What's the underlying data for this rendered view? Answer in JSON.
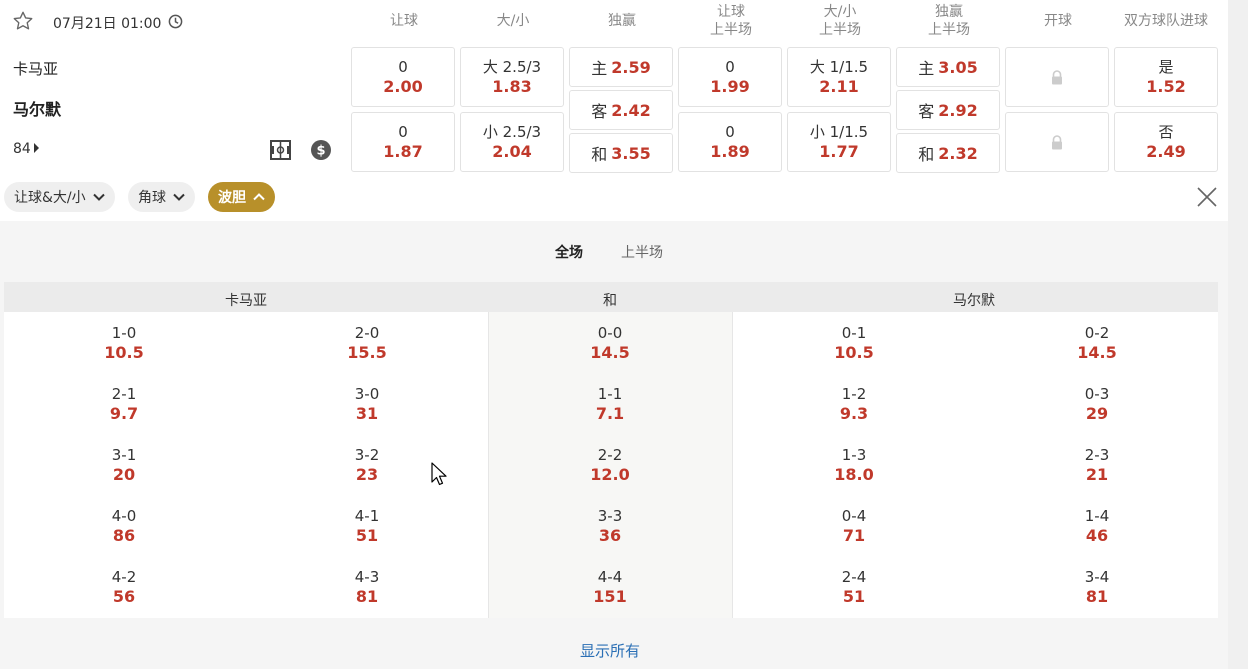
{
  "match": {
    "date": "07月21日 01:00",
    "home": "卡马亚",
    "away": "马尔默",
    "more_count": "84"
  },
  "columns": [
    "让球",
    "大/小",
    "独赢",
    "让球|上半场",
    "大/小|上半场",
    "独赢|上半场",
    "开球",
    "双方球队进球"
  ],
  "odds": {
    "handicap": [
      {
        "line": "0",
        "odd": "2.00"
      },
      {
        "line": "0",
        "odd": "1.87"
      }
    ],
    "total": [
      {
        "line": "大 2.5/3",
        "odd": "1.83"
      },
      {
        "line": "小 2.5/3",
        "odd": "2.04"
      }
    ],
    "moneyline": [
      {
        "label": "主",
        "odd": "2.59"
      },
      {
        "label": "客",
        "odd": "2.42"
      },
      {
        "label": "和",
        "odd": "3.55"
      }
    ],
    "handicap_1h": [
      {
        "line": "0",
        "odd": "1.99"
      },
      {
        "line": "0",
        "odd": "1.89"
      }
    ],
    "total_1h": [
      {
        "line": "大 1/1.5",
        "odd": "2.11"
      },
      {
        "line": "小 1/1.5",
        "odd": "1.77"
      }
    ],
    "moneyline_1h": [
      {
        "label": "主",
        "odd": "3.05"
      },
      {
        "label": "客",
        "odd": "2.92"
      },
      {
        "label": "和",
        "odd": "2.32"
      }
    ],
    "btts": [
      {
        "label": "是",
        "odd": "1.52"
      },
      {
        "label": "否",
        "odd": "2.49"
      }
    ]
  },
  "chips": [
    {
      "label": "让球&大/小",
      "active": false
    },
    {
      "label": "角球",
      "active": false
    },
    {
      "label": "波胆",
      "active": true
    }
  ],
  "correct_score": {
    "tabs": [
      "全场",
      "上半场"
    ],
    "headers": {
      "home": "卡马亚",
      "draw": "和",
      "away": "马尔默"
    },
    "columns": [
      [
        {
          "s": "1-0",
          "o": "10.5"
        },
        {
          "s": "2-1",
          "o": "9.7"
        },
        {
          "s": "3-1",
          "o": "20"
        },
        {
          "s": "4-0",
          "o": "86"
        },
        {
          "s": "4-2",
          "o": "56"
        }
      ],
      [
        {
          "s": "2-0",
          "o": "15.5"
        },
        {
          "s": "3-0",
          "o": "31"
        },
        {
          "s": "3-2",
          "o": "23"
        },
        {
          "s": "4-1",
          "o": "51"
        },
        {
          "s": "4-3",
          "o": "81"
        }
      ],
      [
        {
          "s": "0-0",
          "o": "14.5"
        },
        {
          "s": "1-1",
          "o": "7.1"
        },
        {
          "s": "2-2",
          "o": "12.0"
        },
        {
          "s": "3-3",
          "o": "36"
        },
        {
          "s": "4-4",
          "o": "151"
        }
      ],
      [
        {
          "s": "0-1",
          "o": "10.5"
        },
        {
          "s": "1-2",
          "o": "9.3"
        },
        {
          "s": "1-3",
          "o": "18.0"
        },
        {
          "s": "0-4",
          "o": "71"
        },
        {
          "s": "2-4",
          "o": "51"
        }
      ],
      [
        {
          "s": "0-2",
          "o": "14.5"
        },
        {
          "s": "0-3",
          "o": "29"
        },
        {
          "s": "2-3",
          "o": "21"
        },
        {
          "s": "1-4",
          "o": "46"
        },
        {
          "s": "3-4",
          "o": "81"
        }
      ]
    ],
    "show_all": "显示所有"
  },
  "colors": {
    "odd": "#c0392b",
    "active_chip": "#b8902a",
    "link": "#2a6fb5"
  }
}
